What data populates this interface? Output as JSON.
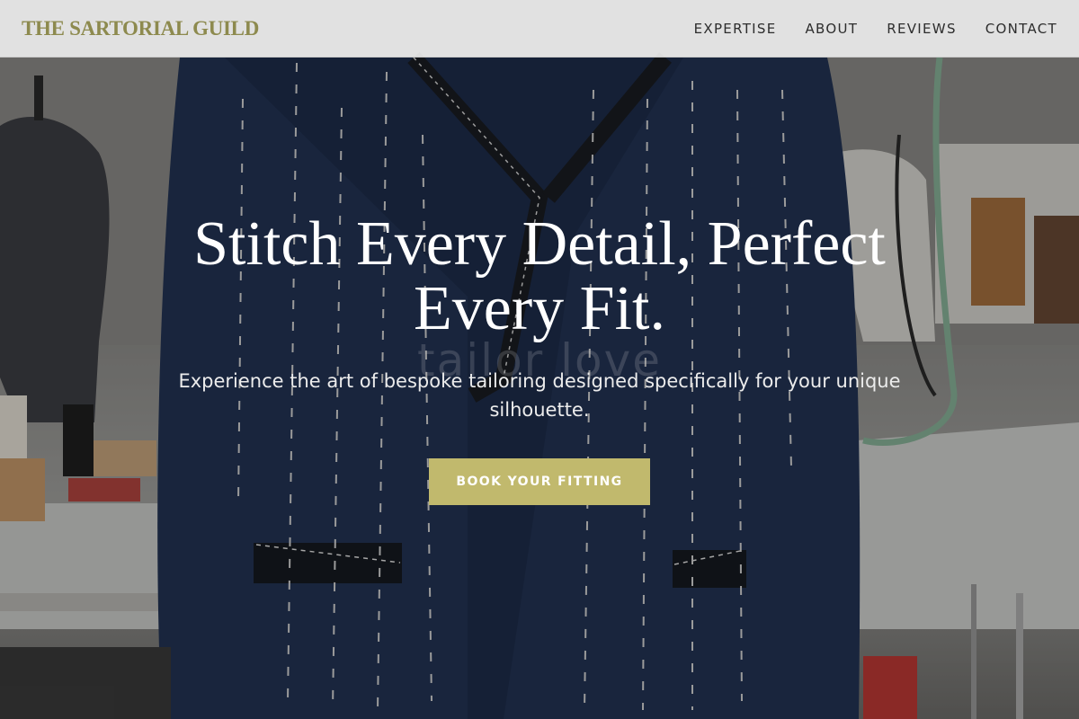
{
  "header": {
    "brand": "THE SARTORIAL GUILD",
    "nav": [
      "EXPERTISE",
      "ABOUT",
      "REVIEWS",
      "CONTACT"
    ]
  },
  "hero": {
    "headline": "Stitch Every Detail, Perfect Every Fit.",
    "subheadline": "Experience the art of bespoke tailoring designed specifically for your unique silhouette.",
    "cta_label": "BOOK YOUR FITTING",
    "watermark_text": "tailor love",
    "image_description_icon": "navy-suit-jacket-on-mannequin-photo"
  },
  "colors": {
    "brand": "#8d8a4e",
    "accent": "#c1b96d",
    "nav_background": "#ececec",
    "suit_navy": "#1f2f4e"
  }
}
